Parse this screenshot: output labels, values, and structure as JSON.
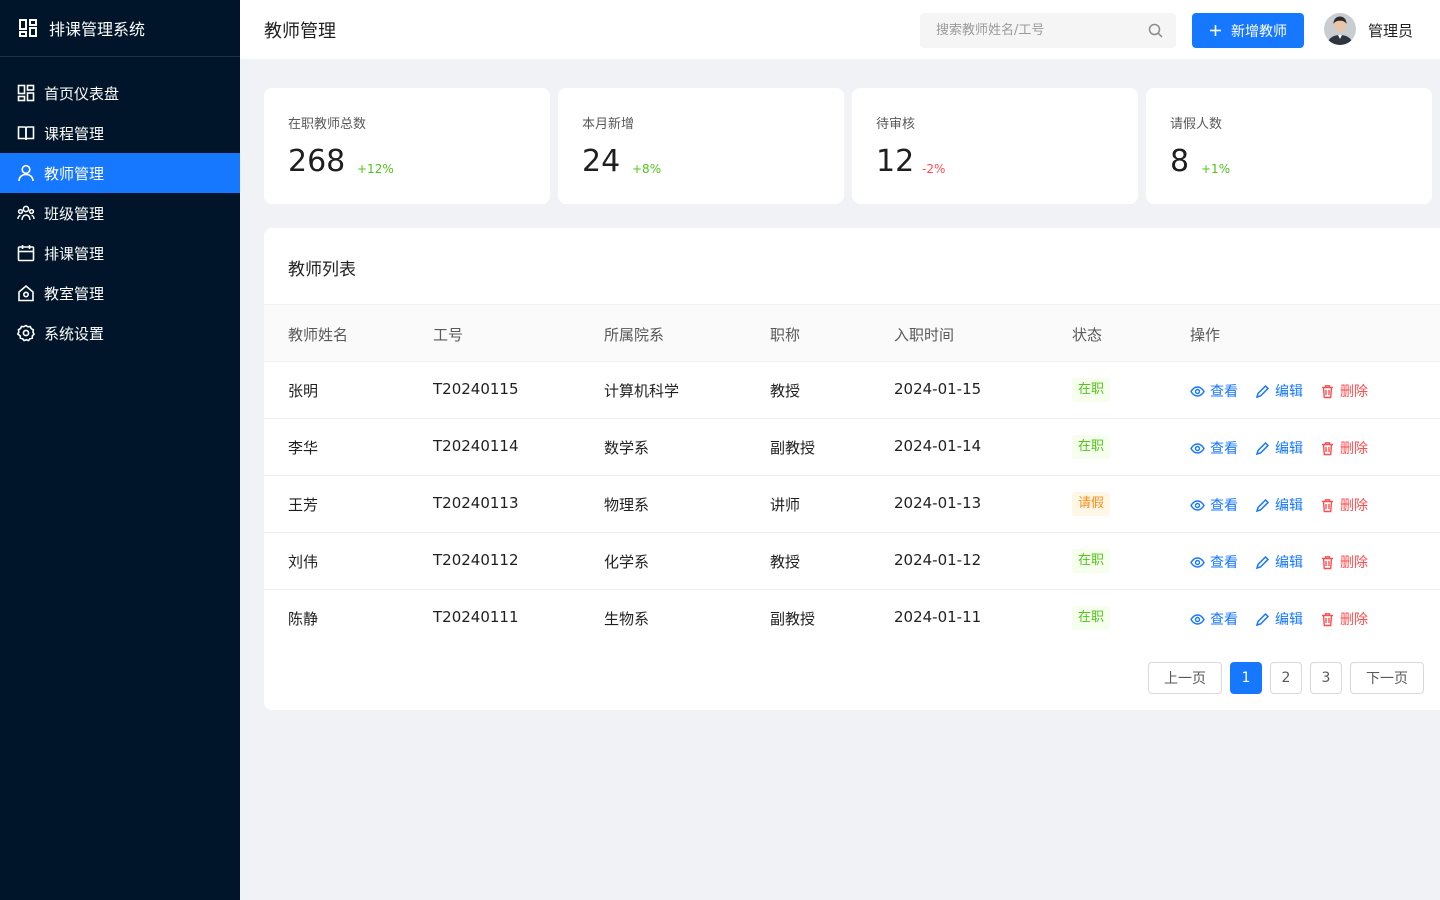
{
  "app": {
    "title": "排课管理系统"
  },
  "sidebar": {
    "items": [
      {
        "label": "首页仪表盘",
        "icon": "dashboard-icon"
      },
      {
        "label": "课程管理",
        "icon": "book-icon"
      },
      {
        "label": "教师管理",
        "icon": "user-icon",
        "active": true
      },
      {
        "label": "班级管理",
        "icon": "team-icon"
      },
      {
        "label": "排课管理",
        "icon": "calendar-icon"
      },
      {
        "label": "教室管理",
        "icon": "home-icon"
      },
      {
        "label": "系统设置",
        "icon": "gear-icon"
      }
    ]
  },
  "header": {
    "title": "教师管理",
    "search_placeholder": "搜索教师姓名/工号",
    "add_label": "新增教师",
    "user_name": "管理员"
  },
  "stats": [
    {
      "label": "在职教师总数",
      "value": "268",
      "change": "+12%",
      "trend": "up"
    },
    {
      "label": "本月新增",
      "value": "24",
      "change": "+8%",
      "trend": "up"
    },
    {
      "label": "待审核",
      "value": "12",
      "change": "-2%",
      "trend": "down"
    },
    {
      "label": "请假人数",
      "value": "8",
      "change": "+1%",
      "trend": "up"
    }
  ],
  "table": {
    "title": "教师列表",
    "columns": [
      "教师姓名",
      "工号",
      "所属院系",
      "职称",
      "入职时间",
      "状态",
      "操作"
    ],
    "rows": [
      {
        "name": "张明",
        "id": "T20240115",
        "dept": "计算机科学",
        "rank": "教授",
        "date": "2024-01-15",
        "status": "在职"
      },
      {
        "name": "李华",
        "id": "T20240114",
        "dept": "数学系",
        "rank": "副教授",
        "date": "2024-01-14",
        "status": "在职"
      },
      {
        "name": "王芳",
        "id": "T20240113",
        "dept": "物理系",
        "rank": "讲师",
        "date": "2024-01-13",
        "status": "请假"
      },
      {
        "name": "刘伟",
        "id": "T20240112",
        "dept": "化学系",
        "rank": "教授",
        "date": "2024-01-12",
        "status": "在职"
      },
      {
        "name": "陈静",
        "id": "T20240111",
        "dept": "生物系",
        "rank": "副教授",
        "date": "2024-01-11",
        "status": "在职"
      }
    ],
    "actions": {
      "view": "查看",
      "edit": "编辑",
      "delete": "删除"
    }
  },
  "pagination": {
    "prev": "上一页",
    "pages": [
      "1",
      "2",
      "3"
    ],
    "current": "1",
    "next": "下一页"
  },
  "colors": {
    "sidebar_bg": "#001529",
    "primary": "#1677ff",
    "success": "#52c41a",
    "warning": "#fa8c16",
    "danger": "#ff4d4f"
  }
}
